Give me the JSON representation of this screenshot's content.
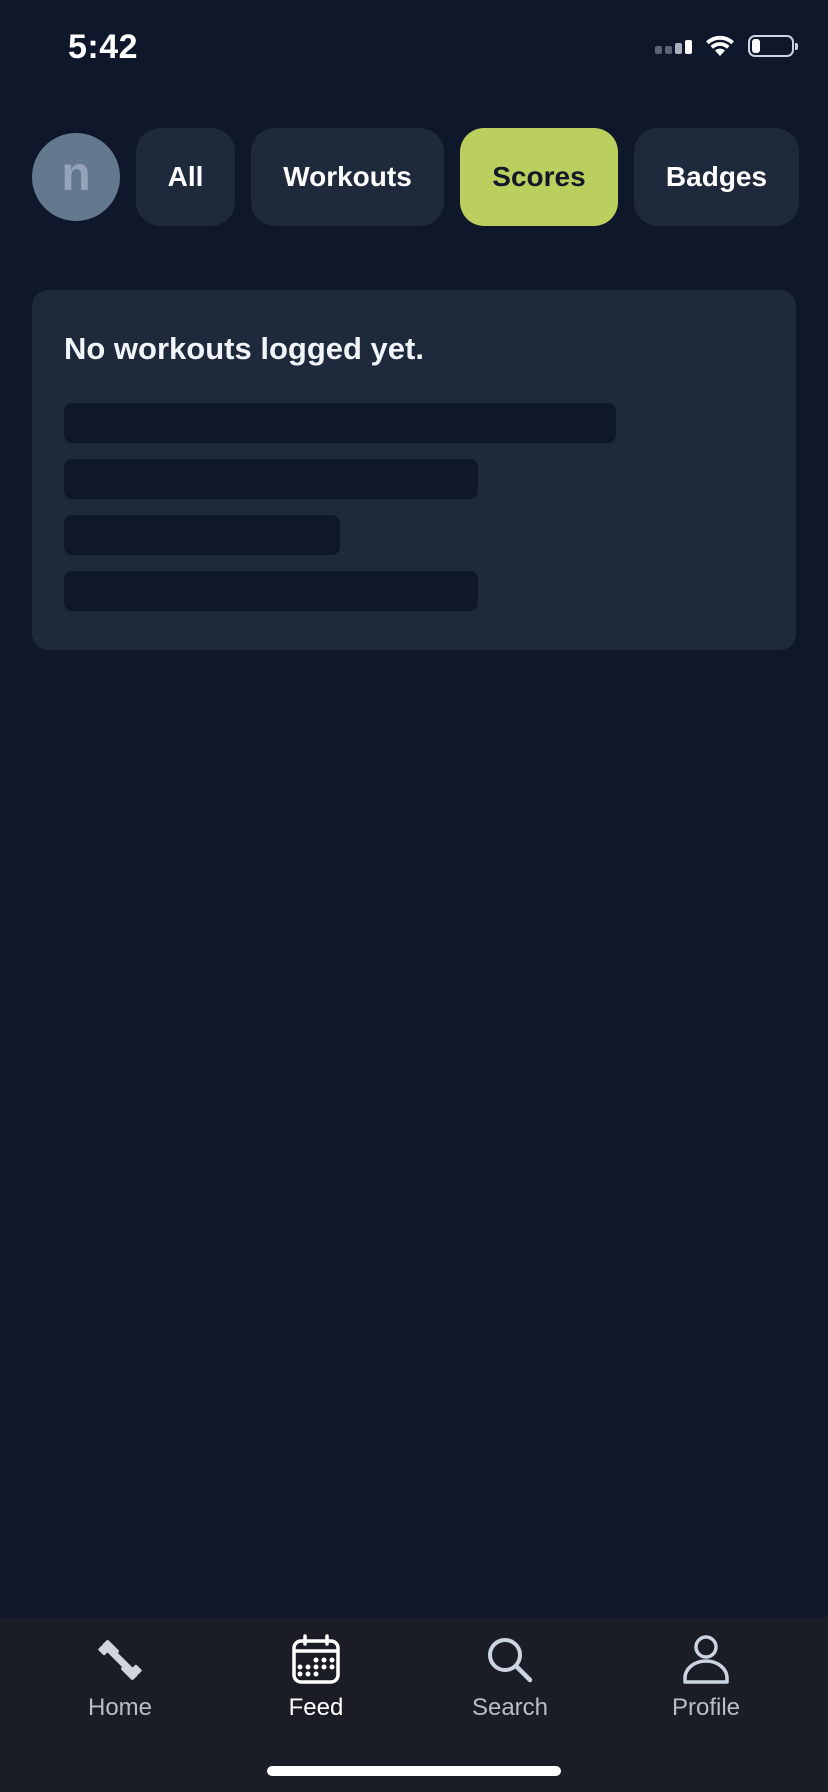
{
  "status_bar": {
    "time": "5:42",
    "battery_level": 0.2
  },
  "profile": {
    "avatar_initial": "n"
  },
  "filters": {
    "items": [
      {
        "label": "All",
        "active": false
      },
      {
        "label": "Workouts",
        "active": false
      },
      {
        "label": "Scores",
        "active": true
      },
      {
        "label": "Badges",
        "active": false
      }
    ],
    "active_color": "#bbcf5e"
  },
  "card": {
    "empty_message": "No workouts logged yet."
  },
  "tab_bar": {
    "items": [
      {
        "label": "Home",
        "icon": "dumbbell-icon",
        "active": false
      },
      {
        "label": "Feed",
        "icon": "calendar-icon",
        "active": true
      },
      {
        "label": "Search",
        "icon": "search-icon",
        "active": false
      },
      {
        "label": "Profile",
        "icon": "person-icon",
        "active": false
      }
    ]
  },
  "colors": {
    "background": "#0f172a",
    "card": "#1e293b",
    "tab_bar": "#1a1c26"
  }
}
